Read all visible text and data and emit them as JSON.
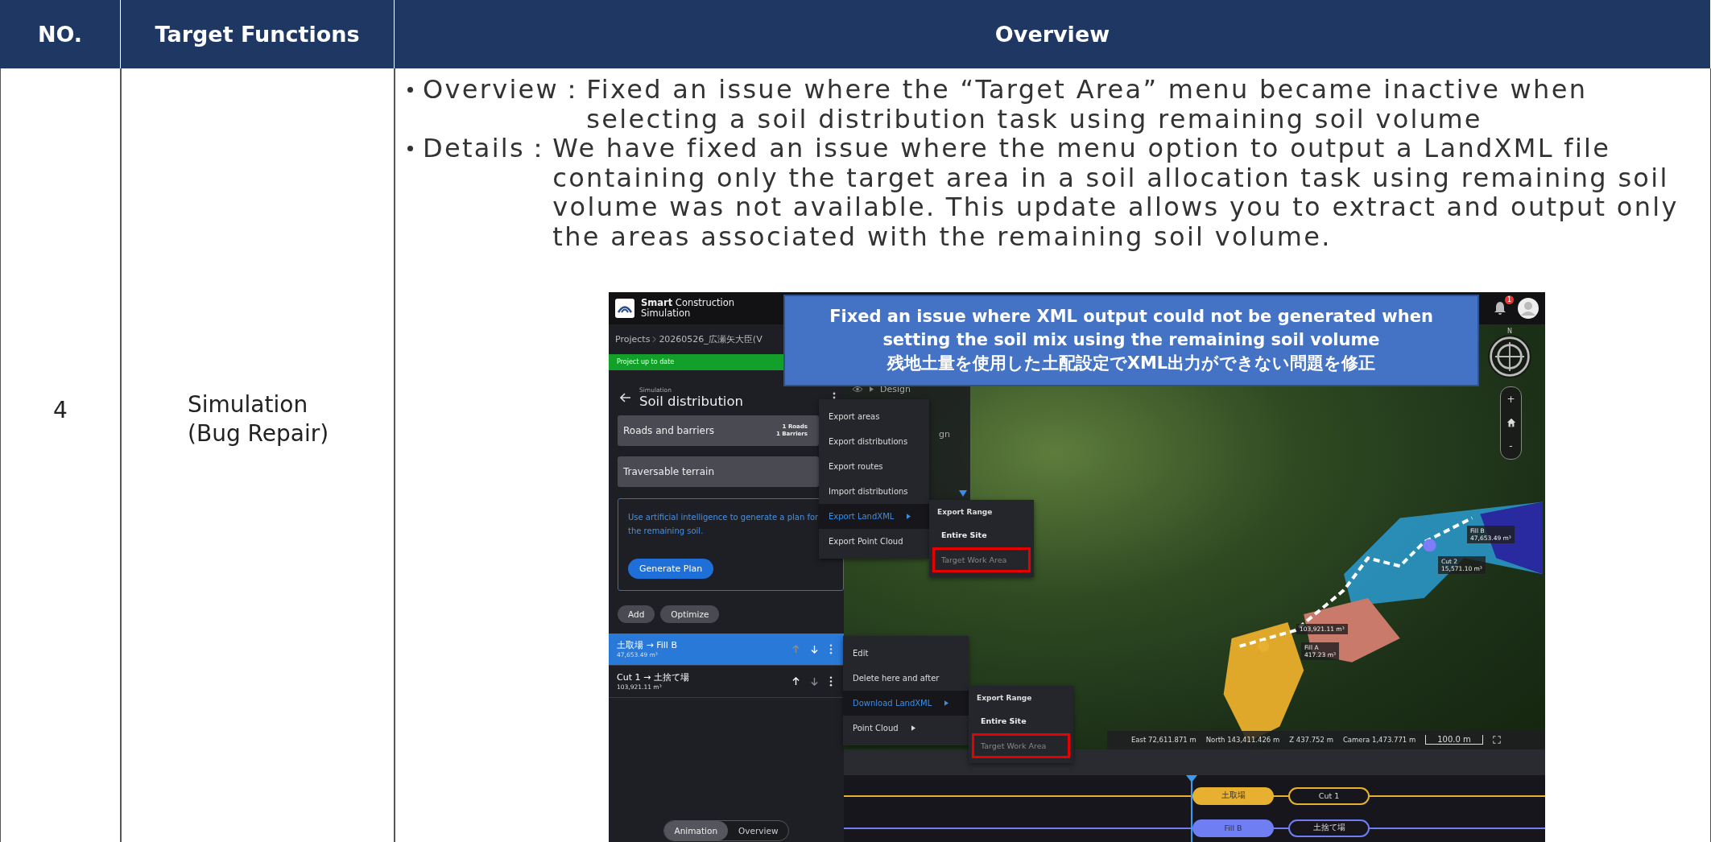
{
  "table": {
    "columns": [
      {
        "label": "NO."
      },
      {
        "label": "Target Functions"
      },
      {
        "label": "Overview"
      }
    ],
    "rows": [
      {
        "number": "4",
        "function": "Simulation\n(Bug Repair)",
        "bullets": [
          {
            "label": "Overview：",
            "text": "Fixed an issue where the “Target Area” menu became inactive when selecting a soil distribution task using remaining soil volume"
          },
          {
            "label": "Details：",
            "text": "We have fixed an issue where the menu option to output a LandXML file containing only the target area in a soil allocation task using remaining soil volume was not available. This update allows you to extract and output only the areas associated with the remaining soil volume."
          }
        ],
        "screenshot": {
          "brand": "**Smart** Construction",
          "brand_line2": "Simulation",
          "notifications": "1",
          "breadcrumb": [
            "Projects",
            "20260526_広瀬矢大臣(V"
          ],
          "status_banner": "Project up to date",
          "page_overline": "Simulation",
          "page_title": "Soil distribution",
          "cards": [
            {
              "kind": "counts",
              "label": "Roads and barriers",
              "counts": [
                "1 Roads",
                "1 Barriers"
              ]
            },
            {
              "kind": "plain",
              "label": "Traversable terrain"
            }
          ],
          "ai_prompt": {
            "text": "Use artificial intelligence to generate a plan for the remaining soil.",
            "button": "Generate Plan"
          },
          "actions": [
            "Add",
            "Optimize"
          ],
          "distributions": [
            {
              "route": "土取場 → Fill B",
              "volume": "47,653.49 m³",
              "selected": true,
              "up_disabled": true,
              "down_disabled": false
            },
            {
              "route": "Cut 1 → 土捨て場",
              "volume": "103,921.11 m³",
              "selected": false,
              "up_disabled": false,
              "down_disabled": true
            }
          ],
          "view_toggle": [
            {
              "label": "Animation",
              "selected": true
            },
            {
              "label": "Overview",
              "selected": false
            }
          ],
          "layers": {
            "label": "Design",
            "fragment": "gn"
          },
          "compass": "N",
          "zoom": [
            "+",
            "-"
          ],
          "map_labels": [
            {
              "lines": [
                "Fill B",
                "47,653.49 m³"
              ]
            },
            {
              "lines": [
                "Cut 2",
                "15,571.10 m³"
              ]
            },
            {
              "lines": [
                "103,921.11 m³"
              ]
            },
            {
              "lines": [
                "Fill A",
                "417.23 m³"
              ]
            }
          ],
          "coordinates": [
            "East 72,611.871 m",
            "North 143,411.426 m",
            "Z 437.752 m",
            "Camera 1,473.771 m"
          ],
          "scale": "100.0 m",
          "menus": [
            {
              "items": [
                {
                  "label": "Export areas",
                  "kind": "action",
                  "highlighted": false
                },
                {
                  "label": "Export distributions",
                  "kind": "action",
                  "highlighted": false
                },
                {
                  "label": "Export routes",
                  "kind": "action",
                  "highlighted": false
                },
                {
                  "label": "Import distributions",
                  "kind": "action",
                  "highlighted": false
                },
                {
                  "label": "Export LandXML",
                  "kind": "submenu",
                  "highlighted": true
                },
                {
                  "label": "Export Point Cloud",
                  "kind": "action",
                  "highlighted": false
                }
              ],
              "submenu": {
                "title": "Export Range",
                "items": [
                  {
                    "label": "Entire Site",
                    "disabled": false,
                    "marked": false
                  },
                  {
                    "label": "Target Work Area",
                    "disabled": true,
                    "marked": true
                  }
                ]
              }
            },
            {
              "items": [
                {
                  "label": "Edit",
                  "kind": "action",
                  "highlighted": false
                },
                {
                  "label": "Delete here and after",
                  "kind": "action",
                  "highlighted": false
                },
                {
                  "label": "Download LandXML",
                  "kind": "submenu",
                  "highlighted": true
                },
                {
                  "label": "Point Cloud",
                  "kind": "submenu",
                  "highlighted": false
                }
              ],
              "submenu": {
                "title": "Export Range",
                "items": [
                  {
                    "label": "Entire Site",
                    "disabled": false,
                    "marked": false
                  },
                  {
                    "label": "Target Work Area",
                    "disabled": true,
                    "marked": true
                  }
                ]
              }
            }
          ],
          "callout": [
            "Fixed an issue where XML output could not be generated when",
            "setting the soil mix using the remaining soil volume",
            "残地土量を使用した土配設定でXML出力ができない問題を修正"
          ],
          "timeline": [
            {
              "color": "#e8b030",
              "from": "土取場",
              "to": "Cut 1"
            },
            {
              "color": "#6f7ef2",
              "from": "Fill B",
              "to": "土捨て場"
            }
          ]
        }
      }
    ]
  }
}
